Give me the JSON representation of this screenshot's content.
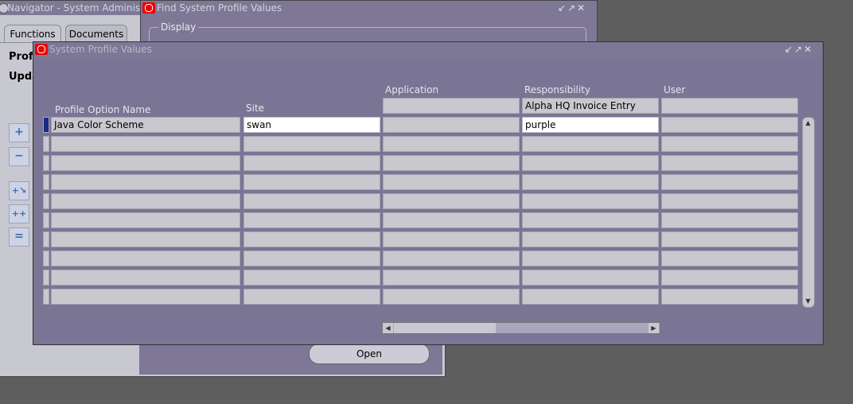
{
  "navigator": {
    "title": "Navigator - System Administrator",
    "tabs": [
      "Functions",
      "Documents"
    ],
    "labels": [
      "Profi",
      "Upda"
    ],
    "open_button": "Open"
  },
  "find_window": {
    "title": "Find System Profile Values",
    "display_label": "Display"
  },
  "spv_window": {
    "title": "System Profile Values",
    "columns": {
      "profile_option_name": "Profile Option Name",
      "site": "Site",
      "application": "Application",
      "responsibility": "Responsibility",
      "user": "User"
    },
    "context": {
      "application": "",
      "responsibility": "Alpha HQ Invoice Entry",
      "user": ""
    },
    "rows": [
      {
        "name": "Java Color Scheme",
        "site": "swan",
        "application": "",
        "responsibility": "purple",
        "user": ""
      },
      {
        "name": "",
        "site": "",
        "application": "",
        "responsibility": "",
        "user": ""
      },
      {
        "name": "",
        "site": "",
        "application": "",
        "responsibility": "",
        "user": ""
      },
      {
        "name": "",
        "site": "",
        "application": "",
        "responsibility": "",
        "user": ""
      },
      {
        "name": "",
        "site": "",
        "application": "",
        "responsibility": "",
        "user": ""
      },
      {
        "name": "",
        "site": "",
        "application": "",
        "responsibility": "",
        "user": ""
      },
      {
        "name": "",
        "site": "",
        "application": "",
        "responsibility": "",
        "user": ""
      },
      {
        "name": "",
        "site": "",
        "application": "",
        "responsibility": "",
        "user": ""
      },
      {
        "name": "",
        "site": "",
        "application": "",
        "responsibility": "",
        "user": ""
      },
      {
        "name": "",
        "site": "",
        "application": "",
        "responsibility": "",
        "user": ""
      }
    ]
  },
  "colors": {
    "window_body": "#7a7594",
    "title_bar": "#7e7896",
    "field_bg": "#c8c8ce",
    "oracle_red": "#e00000"
  }
}
